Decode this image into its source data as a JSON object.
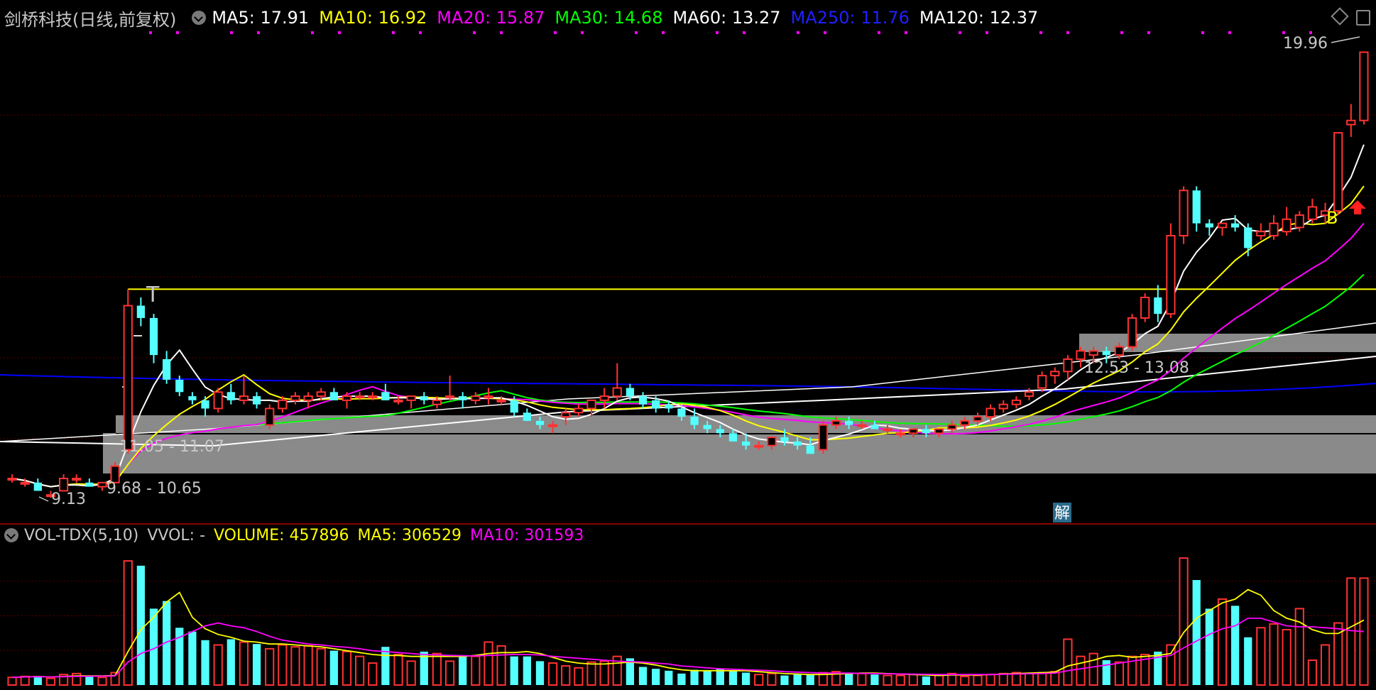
{
  "header": {
    "title": "剑桥科技(日线,前复权)",
    "ma": [
      {
        "label": "MA5: 17.91",
        "color": "#ffffff"
      },
      {
        "label": "MA10: 16.92",
        "color": "#ffff00"
      },
      {
        "label": "MA20: 15.87",
        "color": "#ff00ff"
      },
      {
        "label": "MA30: 14.68",
        "color": "#00ff00"
      },
      {
        "label": "MA60: 13.27",
        "color": "#ffffff"
      },
      {
        "label": "MA250: 11.76",
        "color": "#0000ff"
      },
      {
        "label": "MA120: 12.37",
        "color": "#ffffff"
      }
    ]
  },
  "volume_header": {
    "name": "VOL-TDX(5,10)",
    "vvol": "VVOL: -",
    "volume": "VOLUME: 457896",
    "ma5": "MA5: 306529",
    "ma10": "MA10: 301593"
  },
  "annotations": {
    "high": "19.96",
    "low": "9.13",
    "range_low": "9.68 - 10.65",
    "range_mid": "11.05 - 11.07",
    "range_upper": "12.53 - 13.08",
    "t_mark": "T",
    "b_mark": "B",
    "unlock_mark": "解"
  },
  "colors": {
    "up": "#ff3232",
    "down": "#54ffff",
    "ma5": "#ffffff",
    "ma10": "#ffff00",
    "ma20": "#ff00ff",
    "ma30": "#00ff00",
    "ma250": "#0000ff",
    "grid": "#5a0000",
    "zone": "#8a8a8a",
    "dotted": "#ff00ff"
  },
  "chart_data": {
    "type": "candlestick",
    "price_range": [
      8.6,
      20.4
    ],
    "candles": [
      [
        9.6,
        9.7,
        9.5,
        9.6
      ],
      [
        9.5,
        9.6,
        9.4,
        9.5
      ],
      [
        9.5,
        9.6,
        9.3,
        9.3
      ],
      [
        9.2,
        9.3,
        9.13,
        9.2
      ],
      [
        9.3,
        9.7,
        9.3,
        9.6
      ],
      [
        9.6,
        9.7,
        9.5,
        9.6
      ],
      [
        9.5,
        9.6,
        9.4,
        9.4
      ],
      [
        9.4,
        9.5,
        9.3,
        9.5
      ],
      [
        9.5,
        10.0,
        9.5,
        9.9
      ],
      [
        10.3,
        14.2,
        10.2,
        13.8
      ],
      [
        13.8,
        14.0,
        13.3,
        13.5
      ],
      [
        13.5,
        13.6,
        12.4,
        12.6
      ],
      [
        12.5,
        12.7,
        11.9,
        12.0
      ],
      [
        12.0,
        12.1,
        11.6,
        11.7
      ],
      [
        11.6,
        11.7,
        11.4,
        11.5
      ],
      [
        11.5,
        11.6,
        11.1,
        11.3
      ],
      [
        11.3,
        11.8,
        11.2,
        11.7
      ],
      [
        11.7,
        11.9,
        11.4,
        11.5
      ],
      [
        11.5,
        12.1,
        11.4,
        11.6
      ],
      [
        11.6,
        11.7,
        11.3,
        11.4
      ],
      [
        10.9,
        11.4,
        10.8,
        11.3
      ],
      [
        11.3,
        11.6,
        11.2,
        11.5
      ],
      [
        11.5,
        11.7,
        11.4,
        11.6
      ],
      [
        11.5,
        11.7,
        11.3,
        11.6
      ],
      [
        11.6,
        11.8,
        11.5,
        11.7
      ],
      [
        11.7,
        11.8,
        11.5,
        11.5
      ],
      [
        11.5,
        11.7,
        11.3,
        11.6
      ],
      [
        11.6,
        11.7,
        11.5,
        11.6
      ],
      [
        11.6,
        11.7,
        11.5,
        11.6
      ],
      [
        11.7,
        11.9,
        11.5,
        11.5
      ],
      [
        11.5,
        11.6,
        11.4,
        11.5
      ],
      [
        11.5,
        11.6,
        11.3,
        11.6
      ],
      [
        11.6,
        11.7,
        11.4,
        11.5
      ],
      [
        11.4,
        11.6,
        11.3,
        11.5
      ],
      [
        11.6,
        12.1,
        11.5,
        11.6
      ],
      [
        11.6,
        11.7,
        11.3,
        11.5
      ],
      [
        11.5,
        11.7,
        11.4,
        11.6
      ],
      [
        11.6,
        11.8,
        11.4,
        11.6
      ],
      [
        11.5,
        11.6,
        11.4,
        11.5
      ],
      [
        11.5,
        11.6,
        11.1,
        11.2
      ],
      [
        11.2,
        11.3,
        11.0,
        11.0
      ],
      [
        11.0,
        11.1,
        10.8,
        10.9
      ],
      [
        10.9,
        11.0,
        10.7,
        10.9
      ],
      [
        11.1,
        11.3,
        10.9,
        11.2
      ],
      [
        11.2,
        11.4,
        11.1,
        11.3
      ],
      [
        11.3,
        11.5,
        11.1,
        11.5
      ],
      [
        11.5,
        11.8,
        11.3,
        11.6
      ],
      [
        11.6,
        12.4,
        11.5,
        11.8
      ],
      [
        11.8,
        11.9,
        11.5,
        11.6
      ],
      [
        11.6,
        11.7,
        11.3,
        11.4
      ],
      [
        11.5,
        11.6,
        11.2,
        11.3
      ],
      [
        11.4,
        11.5,
        11.2,
        11.3
      ],
      [
        11.3,
        11.4,
        11.0,
        11.1
      ],
      [
        11.1,
        11.3,
        10.8,
        10.9
      ],
      [
        10.9,
        11.0,
        10.7,
        10.8
      ],
      [
        10.8,
        10.9,
        10.6,
        10.7
      ],
      [
        10.7,
        10.8,
        10.5,
        10.5
      ],
      [
        10.5,
        10.7,
        10.3,
        10.4
      ],
      [
        10.4,
        10.5,
        10.3,
        10.4
      ],
      [
        10.4,
        10.6,
        10.3,
        10.6
      ],
      [
        10.6,
        10.8,
        10.4,
        10.5
      ],
      [
        10.5,
        10.6,
        10.3,
        10.4
      ],
      [
        10.4,
        10.6,
        10.2,
        10.2
      ],
      [
        10.3,
        11.0,
        10.2,
        10.9
      ],
      [
        10.9,
        11.1,
        10.8,
        11.0
      ],
      [
        11.0,
        11.1,
        10.8,
        10.9
      ],
      [
        10.9,
        11.0,
        10.8,
        10.9
      ],
      [
        10.9,
        11.0,
        10.8,
        10.8
      ],
      [
        10.8,
        10.9,
        10.7,
        10.8
      ],
      [
        10.7,
        10.8,
        10.6,
        10.7
      ],
      [
        10.7,
        10.8,
        10.6,
        10.8
      ],
      [
        10.8,
        10.9,
        10.6,
        10.7
      ],
      [
        10.7,
        10.8,
        10.6,
        10.8
      ],
      [
        10.8,
        11.0,
        10.7,
        10.9
      ],
      [
        10.9,
        11.1,
        10.8,
        11.0
      ],
      [
        11.0,
        11.2,
        10.9,
        11.1
      ],
      [
        11.1,
        11.4,
        11.0,
        11.3
      ],
      [
        11.3,
        11.5,
        11.2,
        11.4
      ],
      [
        11.4,
        11.6,
        11.3,
        11.5
      ],
      [
        11.6,
        11.8,
        11.5,
        11.7
      ],
      [
        11.8,
        12.2,
        11.7,
        12.1
      ],
      [
        12.1,
        12.3,
        11.9,
        12.2
      ],
      [
        12.2,
        12.6,
        12.0,
        12.5
      ],
      [
        12.5,
        12.8,
        12.3,
        12.7
      ],
      [
        12.6,
        12.8,
        12.4,
        12.7
      ],
      [
        12.7,
        12.8,
        12.4,
        12.6
      ],
      [
        12.6,
        12.9,
        12.5,
        12.8
      ],
      [
        12.8,
        13.6,
        12.7,
        13.5
      ],
      [
        13.5,
        14.1,
        13.4,
        14.0
      ],
      [
        14.0,
        14.3,
        13.4,
        13.6
      ],
      [
        13.6,
        15.8,
        13.5,
        15.5
      ],
      [
        15.5,
        16.7,
        15.3,
        16.6
      ],
      [
        16.6,
        16.7,
        15.6,
        15.8
      ],
      [
        15.8,
        15.9,
        15.5,
        15.7
      ],
      [
        15.7,
        15.8,
        15.5,
        15.8
      ],
      [
        15.8,
        16.0,
        15.6,
        15.7
      ],
      [
        15.7,
        15.8,
        15.0,
        15.2
      ],
      [
        15.5,
        15.8,
        15.4,
        15.6
      ],
      [
        15.5,
        16.0,
        15.4,
        15.8
      ],
      [
        15.6,
        16.2,
        15.5,
        15.9
      ],
      [
        15.7,
        16.1,
        15.6,
        16.0
      ],
      [
        15.9,
        16.4,
        15.8,
        16.2
      ],
      [
        16.0,
        16.3,
        15.8,
        16.1
      ],
      [
        16.1,
        18.0,
        16.0,
        18.0
      ],
      [
        18.2,
        18.7,
        17.9,
        18.3
      ],
      [
        18.3,
        19.96,
        18.2,
        19.96
      ]
    ],
    "volume_range": [
      0,
      1450000
    ],
    "volumes": [
      80000,
      90000,
      95000,
      70000,
      110000,
      120000,
      90000,
      80000,
      130000,
      1300000,
      1250000,
      800000,
      880000,
      600000,
      560000,
      470000,
      420000,
      480000,
      450000,
      430000,
      380000,
      420000,
      400000,
      410000,
      380000,
      360000,
      350000,
      300000,
      230000,
      400000,
      320000,
      250000,
      350000,
      330000,
      250000,
      310000,
      300000,
      450000,
      410000,
      300000,
      300000,
      250000,
      230000,
      200000,
      180000,
      240000,
      250000,
      300000,
      280000,
      190000,
      170000,
      150000,
      120000,
      160000,
      150000,
      170000,
      150000,
      130000,
      110000,
      120000,
      100000,
      120000,
      110000,
      130000,
      140000,
      130000,
      120000,
      110000,
      100000,
      100000,
      110000,
      90000,
      100000,
      120000,
      90000,
      100000,
      110000,
      120000,
      130000,
      120000,
      130000,
      140000,
      480000,
      300000,
      330000,
      260000,
      240000,
      300000,
      320000,
      350000,
      420000,
      1330000,
      1100000,
      800000,
      900000,
      830000,
      500000,
      600000,
      640000,
      580000,
      800000,
      260000,
      420000,
      650000,
      1120000,
      1120000
    ],
    "vol_ma5": [
      80000,
      85000,
      90000,
      85000,
      90000,
      95000,
      95000,
      95000,
      100000,
      350000,
      580000,
      710000,
      870000,
      970000,
      710000,
      590000,
      530000,
      500000,
      460000,
      450000,
      430000,
      430000,
      420000,
      410000,
      400000,
      380000,
      360000,
      340000,
      320000,
      310000,
      310000,
      300000,
      300000,
      300000,
      300000,
      300000,
      310000,
      330000,
      340000,
      340000,
      350000,
      330000,
      290000,
      250000,
      230000,
      220000,
      220000,
      230000,
      240000,
      230000,
      210000,
      180000,
      160000,
      150000,
      150000,
      150000,
      150000,
      150000,
      140000,
      130000,
      120000,
      115000,
      110000,
      110000,
      115000,
      120000,
      125000,
      125000,
      120000,
      115000,
      110000,
      105000,
      100000,
      105000,
      105000,
      105000,
      110000,
      115000,
      120000,
      125000,
      130000,
      135000,
      200000,
      230000,
      260000,
      300000,
      310000,
      290000,
      300000,
      310000,
      330000,
      550000,
      700000,
      780000,
      860000,
      900000,
      1000000,
      940000,
      780000,
      700000,
      660000,
      580000,
      540000,
      540000,
      610000,
      680000
    ],
    "vol_ma10": [
      80000,
      85000,
      88000,
      85000,
      88000,
      90000,
      92000,
      93000,
      95000,
      240000,
      330000,
      380000,
      450000,
      500000,
      560000,
      620000,
      650000,
      620000,
      600000,
      560000,
      510000,
      470000,
      450000,
      430000,
      420000,
      405000,
      395000,
      380000,
      360000,
      350000,
      340000,
      330000,
      320000,
      315000,
      310000,
      308000,
      305000,
      310000,
      315000,
      320000,
      320000,
      315000,
      300000,
      290000,
      280000,
      270000,
      260000,
      250000,
      245000,
      240000,
      230000,
      220000,
      200000,
      190000,
      180000,
      170000,
      165000,
      160000,
      155000,
      150000,
      140000,
      135000,
      130000,
      125000,
      125000,
      125000,
      122000,
      120000,
      118000,
      116000,
      114000,
      112000,
      110000,
      110000,
      110000,
      110000,
      110000,
      112000,
      115000,
      118000,
      120000,
      125000,
      150000,
      170000,
      190000,
      210000,
      230000,
      250000,
      270000,
      290000,
      310000,
      390000,
      460000,
      530000,
      590000,
      620000,
      700000,
      700000,
      660000,
      620000,
      610000,
      610000,
      600000,
      590000,
      570000,
      560000
    ]
  }
}
